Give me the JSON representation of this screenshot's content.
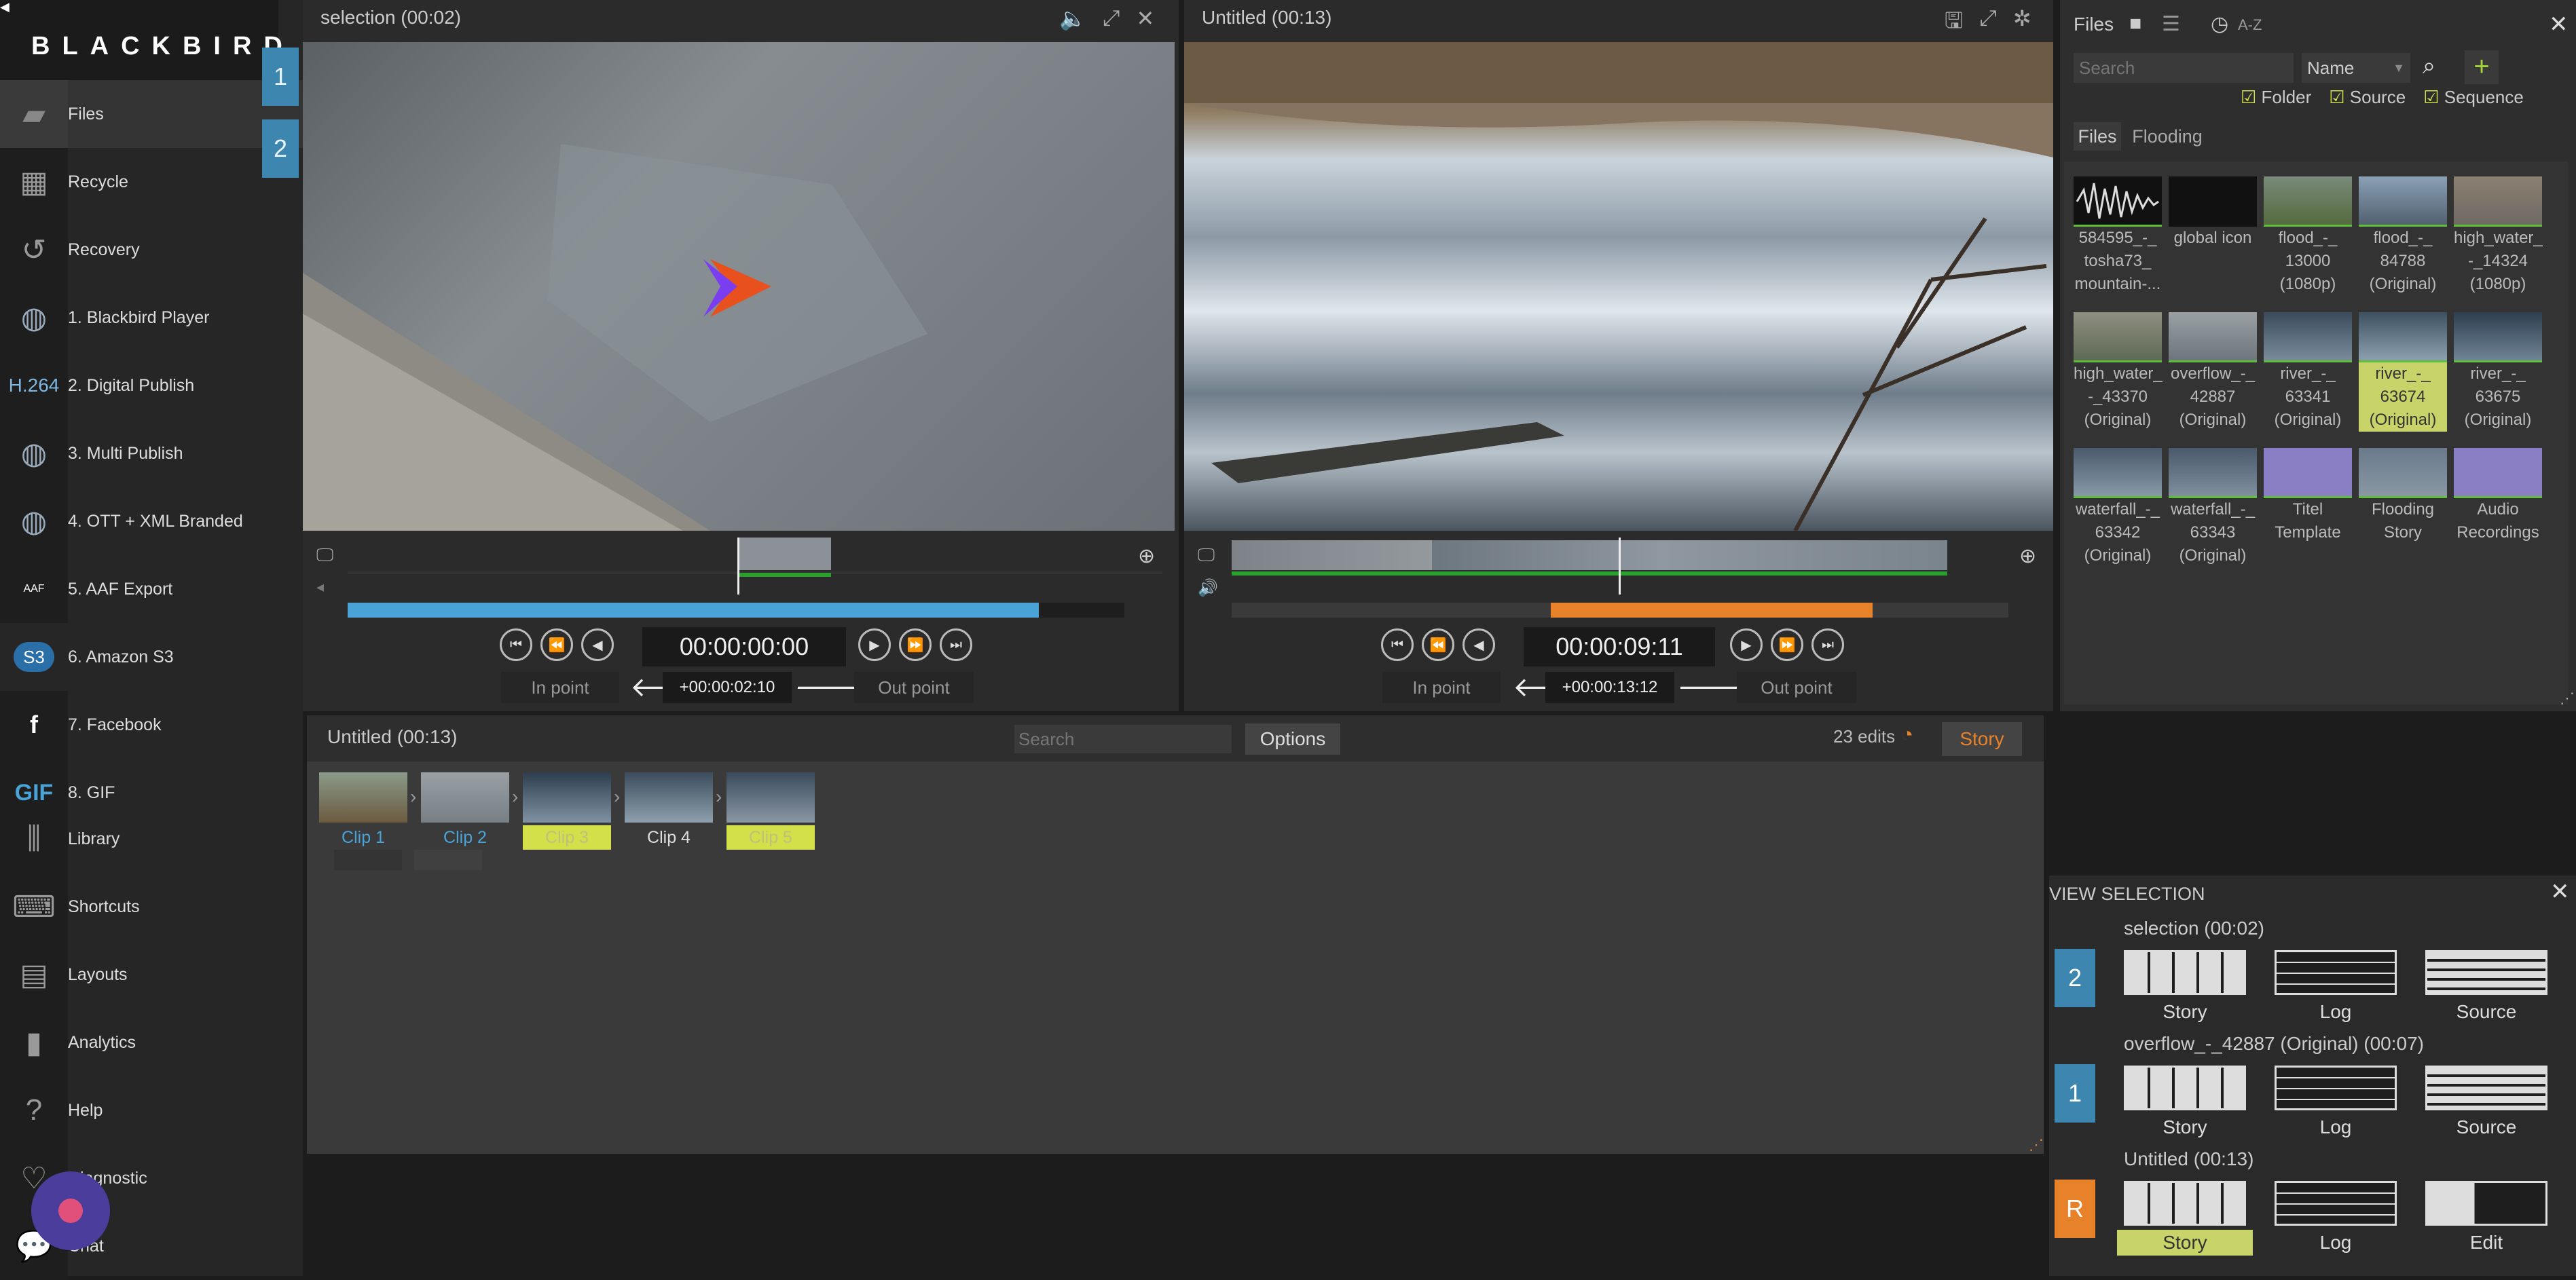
{
  "app": {
    "logo": "BLACKBIRD"
  },
  "sidebar": {
    "items": [
      {
        "label": "Files",
        "icon": "folder-icon"
      },
      {
        "label": "Recycle",
        "icon": "recycle-bin-icon"
      },
      {
        "label": "Recovery",
        "icon": "recovery-clock-icon"
      },
      {
        "label": "1. Blackbird Player",
        "icon": "globe-icon"
      },
      {
        "label": "2. Digital Publish",
        "icon": "h264-icon"
      },
      {
        "label": "3. Multi Publish",
        "icon": "globe-icon"
      },
      {
        "label": "4. OTT + XML Branded",
        "icon": "globe-icon"
      },
      {
        "label": "5. AAF Export",
        "icon": "aaf-icon"
      },
      {
        "label": "6. Amazon S3",
        "icon": "s3-icon"
      },
      {
        "label": "7. Facebook",
        "icon": "facebook-icon"
      },
      {
        "label": "8. GIF",
        "icon": "gif-icon"
      },
      {
        "label": "Library",
        "icon": "library-icon"
      },
      {
        "label": "Shortcuts",
        "icon": "keyboard-icon"
      },
      {
        "label": "Layouts",
        "icon": "layouts-icon"
      },
      {
        "label": "Analytics",
        "icon": "analytics-icon"
      },
      {
        "label": "Help",
        "icon": "help-icon"
      },
      {
        "label": "Diagnostic",
        "icon": "diagnostic-icon"
      },
      {
        "label": "Chat",
        "icon": "chat-icon"
      }
    ],
    "h264_text": "H.264",
    "gif_text": "GIF",
    "s3_text": "S3",
    "aaf_text": "AAF",
    "tabs": [
      "1",
      "2"
    ]
  },
  "viewer_left": {
    "title": "selection (00:02)",
    "timecode": "00:00:00:00",
    "offset": "+00:00:02:10",
    "in_point": "In point",
    "out_point": "Out point",
    "progress": 0.89
  },
  "viewer_right": {
    "title": "Untitled (00:13)",
    "timecode": "00:00:09:11",
    "offset": "+00:00:13:12",
    "in_point": "In point",
    "out_point": "Out point"
  },
  "files_panel": {
    "title": "Files",
    "sort_label": "A-Z",
    "search_placeholder": "Search",
    "sort_select": "Name",
    "filters": [
      {
        "label": "Folder",
        "checked": true
      },
      {
        "label": "Source",
        "checked": true
      },
      {
        "label": "Sequence",
        "checked": true
      }
    ],
    "tabs": [
      "Files",
      "Flooding"
    ],
    "thumbs": [
      {
        "label": "584595_-_ tosha73_ mountain-..."
      },
      {
        "label": "global icon"
      },
      {
        "label": "flood_-_ 13000 (1080p)"
      },
      {
        "label": "flood_-_ 84788 (Original)"
      },
      {
        "label": "high_water_ -_14324 (1080p)"
      },
      {
        "label": "high_water_ -_43370 (Original)"
      },
      {
        "label": "overflow_-_ 42887 (Original)"
      },
      {
        "label": "river_-_ 63341 (Original)"
      },
      {
        "label": "river_-_ 63674 (Original)"
      },
      {
        "label": "river_-_ 63675 (Original)"
      },
      {
        "label": "waterfall_-_ 63342 (Original)"
      },
      {
        "label": "waterfall_-_ 63343 (Original)"
      },
      {
        "label": "Titel Template"
      },
      {
        "label": "Flooding Story"
      },
      {
        "label": "Audio Recordings"
      }
    ]
  },
  "story_panel": {
    "title": "Untitled (00:13)",
    "search_placeholder": "Search",
    "options_label": "Options",
    "edits_count": "23 edits",
    "story_button": "Story",
    "clips": [
      "Clip 1",
      "Clip 2",
      "Clip 3",
      "Clip 4",
      "Clip 5"
    ]
  },
  "view_selection": {
    "title": "VIEW SELECTION",
    "rows": [
      {
        "badge": "2",
        "title": "selection (00:02)",
        "labels": [
          "Story",
          "Log",
          "Source"
        ]
      },
      {
        "badge": "1",
        "title": "overflow_-_42887 (Original) (00:07)",
        "labels": [
          "Story",
          "Log",
          "Source"
        ]
      },
      {
        "badge": "R",
        "title": "Untitled (00:13)",
        "labels": [
          "Story",
          "Log",
          "Edit"
        ]
      }
    ]
  },
  "colors": {
    "accent_blue": "#3d86b0",
    "accent_orange": "#e8822a",
    "highlight_yellow": "#c8d46a"
  }
}
